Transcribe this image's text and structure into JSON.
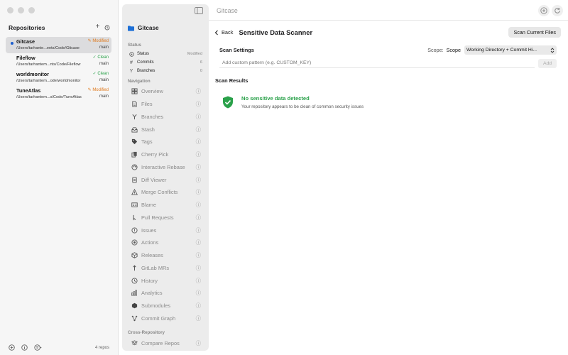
{
  "repos_header": {
    "title": "Repositories"
  },
  "repos": [
    {
      "name": "Gitcase",
      "path": "/Users/tarhante...ents/Code/Gitcase",
      "status": "Modified",
      "branch": "main",
      "selected": true
    },
    {
      "name": "Fileflow",
      "path": "/Users/tarhantem...nts/Code/Fileflow",
      "status": "Clean",
      "branch": "main",
      "selected": false
    },
    {
      "name": "worldmonitor",
      "path": "/Users/tarhantem...ode/worldmonitor",
      "status": "Clean",
      "branch": "main",
      "selected": false
    },
    {
      "name": "TuneAtlas",
      "path": "/Users/tarhantem...s/Code/TuneAtlas",
      "status": "Modified",
      "branch": "main",
      "selected": false
    }
  ],
  "repos_footer": {
    "count": "4 repos"
  },
  "nav": {
    "repo_name": "Gitcase",
    "status_label": "Status",
    "status_rows": [
      {
        "label": "Status",
        "value": "Modified",
        "icon": "status-icon"
      },
      {
        "label": "Commits",
        "value": "6",
        "icon": "hash-icon"
      },
      {
        "label": "Branches",
        "value": "0",
        "icon": "branch-icon"
      }
    ],
    "navigation_label": "Navigation",
    "items": [
      {
        "label": "Overview",
        "icon": "overview-icon"
      },
      {
        "label": "Files",
        "icon": "files-icon"
      },
      {
        "label": "Branches",
        "icon": "branches-icon"
      },
      {
        "label": "Stash",
        "icon": "stash-icon"
      },
      {
        "label": "Tags",
        "icon": "tag-icon"
      },
      {
        "label": "Cherry Pick",
        "icon": "cherry-pick-icon"
      },
      {
        "label": "Interactive Rebase",
        "icon": "rebase-icon"
      },
      {
        "label": "Diff Viewer",
        "icon": "diff-icon"
      },
      {
        "label": "Merge Conflicts",
        "icon": "warning-icon"
      },
      {
        "label": "Blame",
        "icon": "blame-icon"
      },
      {
        "label": "Pull Requests",
        "icon": "pull-request-icon"
      },
      {
        "label": "Issues",
        "icon": "issues-icon"
      },
      {
        "label": "Actions",
        "icon": "actions-icon"
      },
      {
        "label": "Releases",
        "icon": "releases-icon"
      },
      {
        "label": "GitLab MRs",
        "icon": "merge-request-icon"
      },
      {
        "label": "History",
        "icon": "history-icon"
      },
      {
        "label": "Analytics",
        "icon": "analytics-icon"
      },
      {
        "label": "Submodules",
        "icon": "submodules-icon"
      },
      {
        "label": "Commit Graph",
        "icon": "commit-graph-icon"
      }
    ],
    "cross_label": "Cross-Repository",
    "cross_items": [
      {
        "label": "Compare Repos",
        "icon": "compare-icon"
      }
    ]
  },
  "topbar": {
    "title": "Gitcase"
  },
  "page": {
    "back_label": "Back",
    "title": "Sensitive Data Scanner",
    "scan_button": "Scan Current Files",
    "settings_label": "Scan Settings",
    "scope_label": "Scope:",
    "scope_label2": "Scope",
    "scope_value": "Working Directory + Commit Hi...",
    "pattern_placeholder": "Add custom pattern (e.g. CUSTOM_KEY)",
    "add_label": "Add",
    "results_label": "Scan Results",
    "result_title": "No sensitive data detected",
    "result_subtitle": "Your repository appears to be clean of common security issues"
  },
  "colors": {
    "accent": "#1d5fcf",
    "modified": "#e07b1f",
    "clean": "#2aa14a"
  }
}
